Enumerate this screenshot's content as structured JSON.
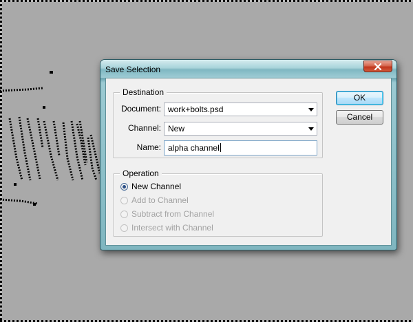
{
  "dialog": {
    "title": "Save Selection",
    "destination": {
      "legend": "Destination",
      "document_label": "Document:",
      "document_value": "work+bolts.psd",
      "channel_label": "Channel:",
      "channel_value": "New",
      "name_label": "Name:",
      "name_value": "alpha channel"
    },
    "operation": {
      "legend": "Operation",
      "options": [
        {
          "label": "New Channel",
          "checked": true,
          "enabled": true
        },
        {
          "label": "Add to Channel",
          "checked": false,
          "enabled": false
        },
        {
          "label": "Subtract from Channel",
          "checked": false,
          "enabled": false
        },
        {
          "label": "Intersect with Channel",
          "checked": false,
          "enabled": false
        }
      ]
    },
    "buttons": {
      "ok": "OK",
      "cancel": "Cancel"
    }
  },
  "colors": {
    "canvas_bg": "#a9a9a9",
    "close_button": "#c1371d",
    "default_button_border": "#3c7fb1",
    "disabled_text": "#a2a2a2"
  }
}
